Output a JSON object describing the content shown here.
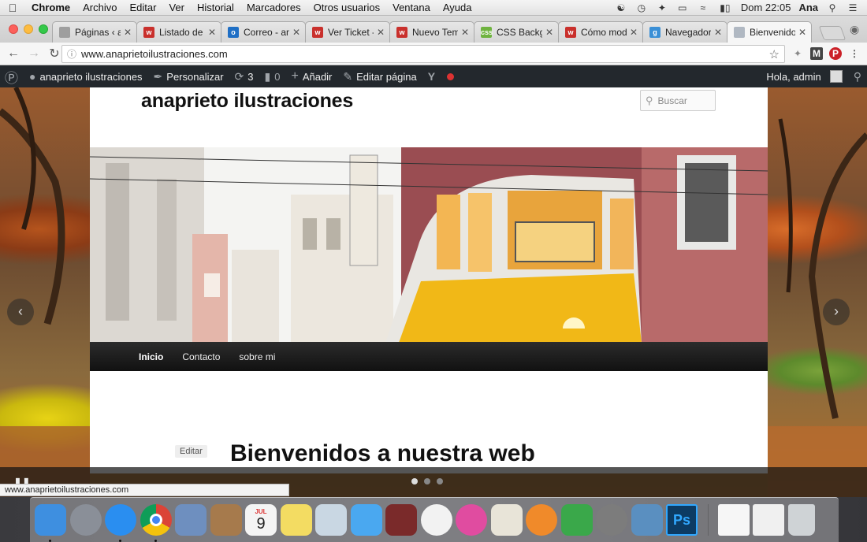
{
  "menubar": {
    "app": "Chrome",
    "items": [
      "Archivo",
      "Editar",
      "Ver",
      "Historial",
      "Marcadores",
      "Otros usuarios",
      "Ventana",
      "Ayuda"
    ],
    "clock": "Dom 22:05",
    "user": "Ana"
  },
  "tabs": [
    {
      "label": "Páginas ‹ an",
      "fav_color": "#9e9e9e",
      "fav_text": ""
    },
    {
      "label": "Listado de p",
      "fav_color": "#c9302c",
      "fav_text": "w"
    },
    {
      "label": "Correo - ana",
      "fav_color": "#1f6fc5",
      "fav_text": "o"
    },
    {
      "label": "Ver Ticket - ",
      "fav_color": "#c9302c",
      "fav_text": "w"
    },
    {
      "label": "Nuevo Tema",
      "fav_color": "#c9302c",
      "fav_text": "w"
    },
    {
      "label": "CSS Backgro",
      "fav_color": "#6fb33f",
      "fav_text": "css"
    },
    {
      "label": "Cómo modif",
      "fav_color": "#c9302c",
      "fav_text": "w"
    },
    {
      "label": "Navegador C",
      "fav_color": "#3a8fd6",
      "fav_text": "g"
    },
    {
      "label": "Bienvenidos",
      "fav_color": "#b0b8c2",
      "fav_text": ""
    }
  ],
  "active_tab_index": 8,
  "toolbar": {
    "url": "www.anaprietoilustraciones.com"
  },
  "wpbar": {
    "site_name": "anaprieto ilustraciones",
    "customize": "Personalizar",
    "updates": "3",
    "comments": "0",
    "add_new": "Añadir",
    "edit_page": "Editar página",
    "greeting": "Hola, admin"
  },
  "site": {
    "title": "anaprieto ilustraciones",
    "search_placeholder": "Buscar",
    "nav": [
      "Inicio",
      "Contacto",
      "sobre mi"
    ],
    "edit_label": "Editar",
    "heading": "Bienvenidos a nuestra web"
  },
  "slideshow": {
    "dots": 3,
    "active_dot": 0
  },
  "status_url": "www.anaprietoilustraciones.com",
  "dock": [
    {
      "name": "finder-icon",
      "color": "#3e8fe0",
      "run": true
    },
    {
      "name": "launchpad-icon",
      "color": "#8a8f98",
      "run": false
    },
    {
      "name": "safari-icon",
      "color": "#2a8ef0",
      "run": true
    },
    {
      "name": "chrome-icon",
      "color": "#e24a3a",
      "run": true
    },
    {
      "name": "mail-icon",
      "color": "#6e8fbf",
      "run": false
    },
    {
      "name": "contacts-icon",
      "color": "#a67a4c",
      "run": false
    },
    {
      "name": "calendar-icon",
      "color": "#f4f4f4",
      "run": false
    },
    {
      "name": "notes-icon",
      "color": "#f3dc62",
      "run": false
    },
    {
      "name": "preview-icon",
      "color": "#c9d7e3",
      "run": false
    },
    {
      "name": "messages-icon",
      "color": "#4aa8f0",
      "run": false
    },
    {
      "name": "photo-booth-icon",
      "color": "#7a2a2a",
      "run": false
    },
    {
      "name": "photos-icon",
      "color": "#f2f2f2",
      "run": false
    },
    {
      "name": "itunes-icon",
      "color": "#e04ca0",
      "run": false
    },
    {
      "name": "textedit-icon",
      "color": "#e8e4d8",
      "run": false
    },
    {
      "name": "ibooks-icon",
      "color": "#f08a2a",
      "run": false
    },
    {
      "name": "numbers-icon",
      "color": "#3aa84a",
      "run": false
    },
    {
      "name": "system-preferences-icon",
      "color": "#7c7c7c",
      "run": false
    },
    {
      "name": "image-capture-icon",
      "color": "#5a8fc0",
      "run": false
    },
    {
      "name": "photoshop-icon",
      "color": "#0c3b63",
      "run": false
    }
  ],
  "dock_calendar": {
    "month": "JUL",
    "day": "9"
  },
  "dock_photoshop_label": "Ps",
  "dock_right": [
    {
      "name": "document-icon",
      "color": "#f6f6f6"
    },
    {
      "name": "preview-document-icon",
      "color": "#f0f0f0"
    },
    {
      "name": "trash-icon",
      "color": "#cfd3d6"
    }
  ]
}
